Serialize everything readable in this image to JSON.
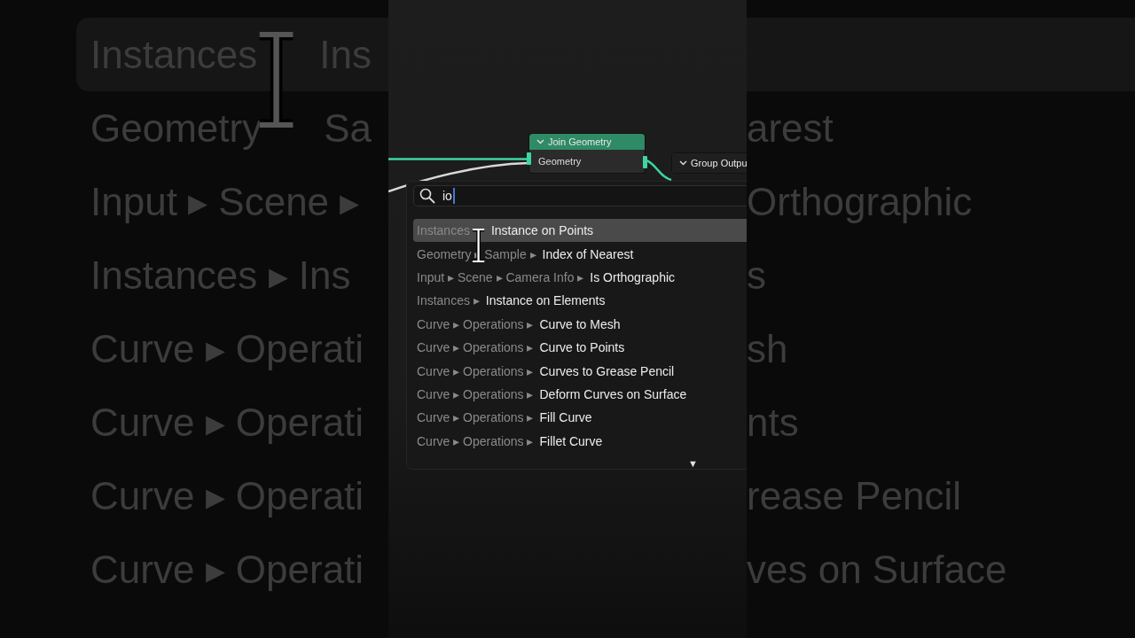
{
  "backdrop": {
    "rows": [
      {
        "selected": true,
        "left": "Instances",
        "left_name": "Ins"
      },
      {
        "selected": false,
        "left": "Geometry",
        "left_name": "Sa",
        "right": "arest"
      },
      {
        "selected": false,
        "left": "Input ▸ Scene ▸",
        "right": "Orthographic"
      },
      {
        "selected": false,
        "left": "Instances ▸  Ins",
        "right": "s"
      },
      {
        "selected": false,
        "left": "Curve ▸ Operati",
        "right": "sh"
      },
      {
        "selected": false,
        "left": "Curve ▸ Operati",
        "right": "nts"
      },
      {
        "selected": false,
        "left": "Curve ▸ Operati",
        "right": "rease Pencil"
      },
      {
        "selected": false,
        "left": "Curve ▸ Operati",
        "right": "ves on Surface"
      }
    ]
  },
  "nodes": [
    {
      "kind": "join",
      "title": "Join Geometry",
      "sockets": [
        "Geometry"
      ]
    },
    {
      "kind": "output",
      "title": "Group Outpu"
    }
  ],
  "search": {
    "value": "io"
  },
  "results": [
    {
      "path": "Instances",
      "name": "Instance on Points",
      "selected": true
    },
    {
      "path": "Geometry ▸ Sample ▸",
      "name": "Index of Nearest",
      "selected": false
    },
    {
      "path": "Input ▸ Scene ▸ Camera Info ▸",
      "name": "Is Orthographic",
      "selected": false
    },
    {
      "path": "Instances ▸",
      "name": "Instance on Elements",
      "selected": false
    },
    {
      "path": "Curve ▸ Operations ▸",
      "name": "Curve to Mesh",
      "selected": false
    },
    {
      "path": "Curve ▸ Operations ▸",
      "name": "Curve to Points",
      "selected": false
    },
    {
      "path": "Curve ▸ Operations ▸",
      "name": "Curves to Grease Pencil",
      "selected": false
    },
    {
      "path": "Curve ▸ Operations ▸",
      "name": "Deform Curves on Surface",
      "selected": false
    },
    {
      "path": "Curve ▸ Operations ▸",
      "name": "Fill Curve",
      "selected": false
    },
    {
      "path": "Curve ▸ Operations ▸",
      "name": "Fillet Curve",
      "selected": false
    }
  ],
  "scroll_more": "▼"
}
